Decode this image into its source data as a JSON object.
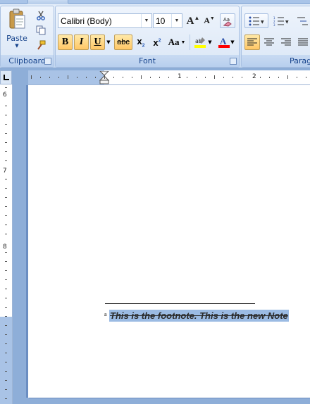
{
  "ribbon": {
    "clipboard": {
      "label": "Clipboard",
      "paste_label": "Paste"
    },
    "font": {
      "label": "Font",
      "font_name": "Calibri (Body)",
      "font_size": "10",
      "underline_label": "U",
      "strike_label": "abc",
      "change_case_label": "Aa"
    },
    "paragraph": {
      "label": "Parag"
    },
    "colors": {
      "highlight": "#ffff00",
      "font_color": "#ff0000",
      "active_bg": "#ffc766",
      "group_label": "#15428b"
    }
  },
  "ruler": {
    "h_numbers": [
      "1",
      "2"
    ],
    "v_numbers": [
      "6",
      "7",
      "8"
    ]
  },
  "document": {
    "footnote_mark": "a",
    "footnote_text": "This is the footnote. This is the new Note"
  }
}
